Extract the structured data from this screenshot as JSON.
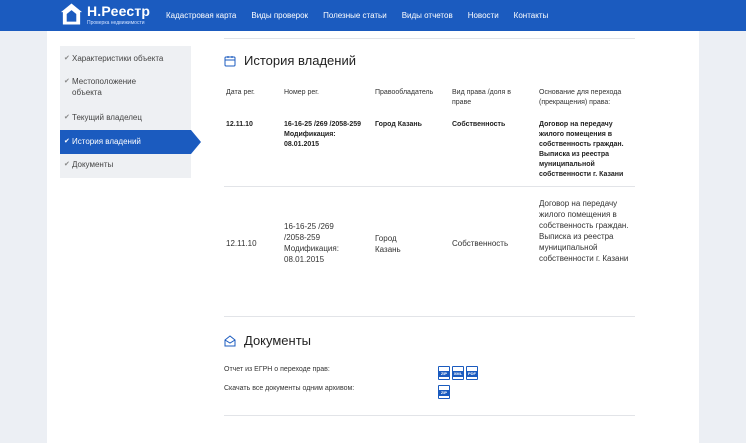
{
  "brand": {
    "title": "Н.Реестр",
    "subtitle": "Проверка недвижимости"
  },
  "nav": [
    "Кадастровая карта",
    "Виды проверок",
    "Полезные статьи",
    "Виды отчетов",
    "Новости",
    "Контакты"
  ],
  "sidebar": [
    {
      "label": "Характеристики объекта",
      "active": false
    },
    {
      "label": "Местоположение объекта",
      "active": false
    },
    {
      "label": "Текущий владелец",
      "active": false
    },
    {
      "label": "История владений",
      "active": true
    },
    {
      "label": "Документы",
      "active": false
    }
  ],
  "history": {
    "title": "История владений",
    "columns": [
      "Дата рег.",
      "Номер рег.",
      "Правообладатель",
      "Вид права /доля в праве",
      "Основание для перехода (прекращения) права:"
    ],
    "rows": [
      {
        "date": "12.11.10",
        "number": "16-16-25 /269 /2058-259 Модификация: 08.01.2015",
        "owner": "Город Казань",
        "right": "Собственность",
        "basis": "Договор на передачу жилого помещения в собственность граждан. Выписка из реестра муниципальной собственности г. Казани"
      },
      {
        "date": "12.11.10",
        "number": "16-16-25 /269 /2058-259 Модификация: 08.01.2015",
        "owner": "Город Казань",
        "right": "Собственность",
        "basis": "Договор на передачу жилого помещения в собственность граждан. Выписка из реестра муниципальной собственности г. Казани"
      }
    ]
  },
  "documents": {
    "title": "Документы",
    "items": [
      {
        "label": "Отчет из ЕГРН о переходе прав:",
        "files": [
          "ZIP",
          "XML",
          "PDF"
        ]
      },
      {
        "label": "Скачать все документы одним архивом:",
        "files": [
          "ZIP"
        ]
      }
    ]
  },
  "colors": {
    "brand": "#1b5bbf",
    "page_bg": "#eceff4"
  },
  "icons": [
    "house-icon",
    "checkmark-icon",
    "calendar-icon",
    "envelope-icon",
    "file-icon"
  ]
}
